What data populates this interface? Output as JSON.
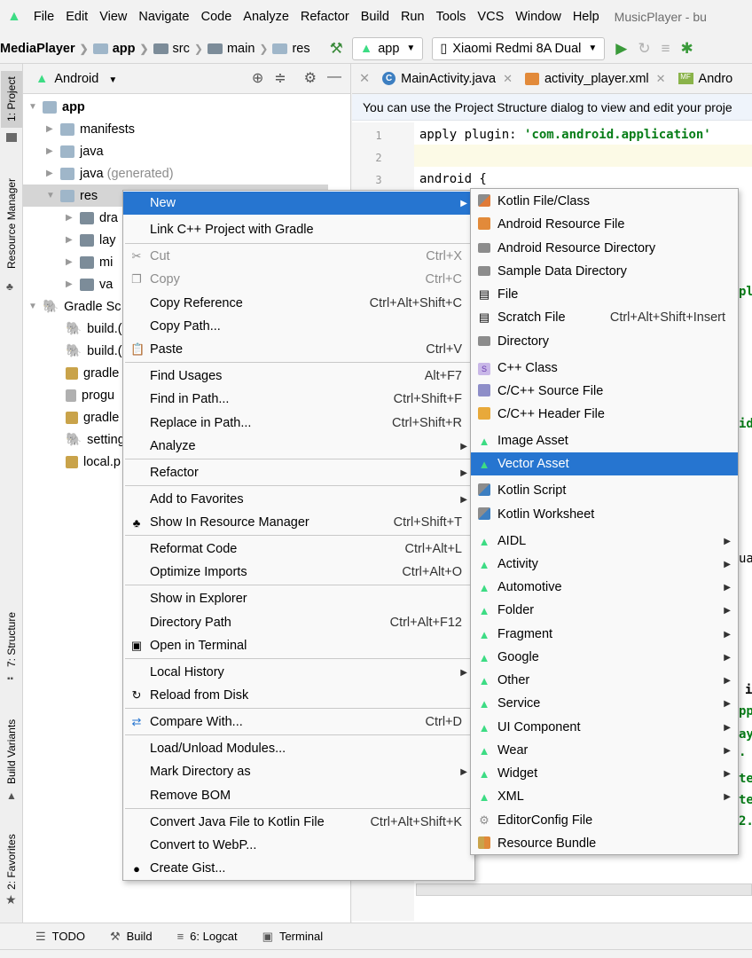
{
  "menubar": {
    "items": [
      "File",
      "Edit",
      "View",
      "Navigate",
      "Code",
      "Analyze",
      "Refactor",
      "Build",
      "Run",
      "Tools",
      "VCS",
      "Window",
      "Help"
    ],
    "title": "MusicPlayer - bu"
  },
  "navbar": {
    "breadcrumbs": [
      "MediaPlayer",
      "app",
      "src",
      "main",
      "res"
    ],
    "run_config": "app",
    "device": "Xiaomi Redmi 8A Dual"
  },
  "left_strip": {
    "tabs": [
      "1: Project",
      "Resource Manager",
      "7: Structure",
      "Build Variants",
      "2: Favorites"
    ]
  },
  "project_panel": {
    "view_selector": "Android",
    "tree": [
      {
        "label": "app",
        "bold": true
      },
      {
        "label": "manifests"
      },
      {
        "label": "java"
      },
      {
        "label": "java",
        "suffix": "(generated)"
      },
      {
        "label": "res"
      },
      {
        "label": "dra"
      },
      {
        "label": "lay"
      },
      {
        "label": "mi"
      },
      {
        "label": "va"
      },
      {
        "label": "Gradle Sc"
      },
      {
        "label": "build.("
      },
      {
        "label": "build.("
      },
      {
        "label": "gradle"
      },
      {
        "label": "progu"
      },
      {
        "label": "gradle"
      },
      {
        "label": "setting"
      },
      {
        "label": "local.p"
      }
    ]
  },
  "editor": {
    "tabs": [
      "MainActivity.java",
      "activity_player.xml",
      "Andro"
    ],
    "notice": "You can use the Project Structure dialog to view and edit your proje",
    "line_numbers": [
      "1",
      "2",
      "3"
    ],
    "line1_prefix": "apply plugin: ",
    "line1_string": "'com.android.application'",
    "line3": "android {",
    "edge_fragments": [
      "pl",
      "id",
      "ua",
      "i",
      "pp",
      "ay",
      ".",
      "te",
      "te",
      "2."
    ]
  },
  "context_menu": {
    "items": [
      {
        "label": "New",
        "submenu": true,
        "selected": true
      },
      {
        "label": "Link C++ Project with Gradle"
      },
      {
        "label": "Cut",
        "shortcut": "Ctrl+X",
        "disabled": true
      },
      {
        "label": "Copy",
        "shortcut": "Ctrl+C",
        "disabled": true
      },
      {
        "label": "Copy Reference",
        "shortcut": "Ctrl+Alt+Shift+C"
      },
      {
        "label": "Copy Path..."
      },
      {
        "label": "Paste",
        "shortcut": "Ctrl+V"
      },
      {
        "label": "Find Usages",
        "shortcut": "Alt+F7"
      },
      {
        "label": "Find in Path...",
        "shortcut": "Ctrl+Shift+F"
      },
      {
        "label": "Replace in Path...",
        "shortcut": "Ctrl+Shift+R"
      },
      {
        "label": "Analyze",
        "submenu": true
      },
      {
        "label": "Refactor",
        "submenu": true
      },
      {
        "label": "Add to Favorites",
        "submenu": true
      },
      {
        "label": "Show In Resource Manager",
        "shortcut": "Ctrl+Shift+T"
      },
      {
        "label": "Reformat Code",
        "shortcut": "Ctrl+Alt+L"
      },
      {
        "label": "Optimize Imports",
        "shortcut": "Ctrl+Alt+O"
      },
      {
        "label": "Show in Explorer"
      },
      {
        "label": "Directory Path",
        "shortcut": "Ctrl+Alt+F12"
      },
      {
        "label": "Open in Terminal"
      },
      {
        "label": "Local History",
        "submenu": true
      },
      {
        "label": "Reload from Disk"
      },
      {
        "label": "Compare With...",
        "shortcut": "Ctrl+D"
      },
      {
        "label": "Load/Unload Modules..."
      },
      {
        "label": "Mark Directory as",
        "submenu": true
      },
      {
        "label": "Remove BOM"
      },
      {
        "label": "Convert Java File to Kotlin File",
        "shortcut": "Ctrl+Alt+Shift+K"
      },
      {
        "label": "Convert to WebP..."
      },
      {
        "label": "Create Gist..."
      }
    ]
  },
  "new_submenu": {
    "items": [
      {
        "label": "Kotlin File/Class"
      },
      {
        "label": "Android Resource File"
      },
      {
        "label": "Android Resource Directory"
      },
      {
        "label": "Sample Data Directory"
      },
      {
        "label": "File"
      },
      {
        "label": "Scratch File",
        "shortcut": "Ctrl+Alt+Shift+Insert"
      },
      {
        "label": "Directory"
      },
      {
        "label": "C++ Class"
      },
      {
        "label": "C/C++ Source File"
      },
      {
        "label": "C/C++ Header File"
      },
      {
        "label": "Image Asset"
      },
      {
        "label": "Vector Asset",
        "selected": true
      },
      {
        "label": "Kotlin Script"
      },
      {
        "label": "Kotlin Worksheet"
      },
      {
        "label": "AIDL",
        "submenu": true
      },
      {
        "label": "Activity",
        "submenu": true
      },
      {
        "label": "Automotive",
        "submenu": true
      },
      {
        "label": "Folder",
        "submenu": true
      },
      {
        "label": "Fragment",
        "submenu": true
      },
      {
        "label": "Google",
        "submenu": true
      },
      {
        "label": "Other",
        "submenu": true
      },
      {
        "label": "Service",
        "submenu": true
      },
      {
        "label": "UI Component",
        "submenu": true
      },
      {
        "label": "Wear",
        "submenu": true
      },
      {
        "label": "Widget",
        "submenu": true
      },
      {
        "label": "XML",
        "submenu": true
      },
      {
        "label": "EditorConfig File"
      },
      {
        "label": "Resource Bundle"
      }
    ]
  },
  "bottom_bar": {
    "tabs": [
      "TODO",
      "Build",
      "6: Logcat",
      "Terminal"
    ]
  },
  "colors": {
    "selection": "#2675d0",
    "android_green": "#3ddc84",
    "string_green": "#067d17"
  }
}
